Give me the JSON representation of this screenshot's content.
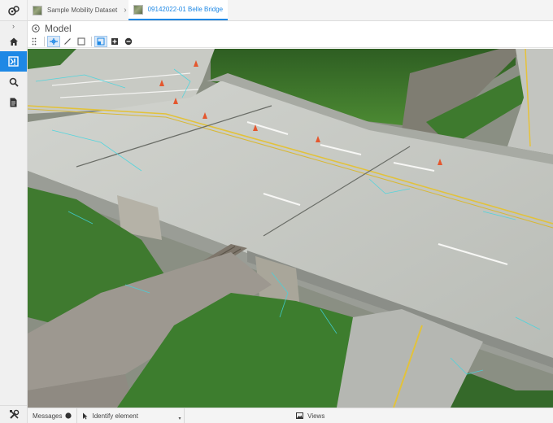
{
  "breadcrumb": {
    "items": [
      {
        "label": "Sample Mobility Dataset",
        "active": false
      },
      {
        "label": "09142022-01 Belle Bridge",
        "active": true
      }
    ]
  },
  "sidebar": {
    "items": [
      {
        "name": "home",
        "icon": "home-icon"
      },
      {
        "name": "model",
        "icon": "model-icon",
        "active": true
      },
      {
        "name": "search",
        "icon": "search-icon"
      },
      {
        "name": "document",
        "icon": "document-icon"
      }
    ],
    "bottom_icon": "tools-icon"
  },
  "panel": {
    "title": "Model"
  },
  "toolbar": {
    "tools": [
      "grip-icon",
      "measure-point-icon",
      "measure-line-icon",
      "box-select-icon",
      "section-icon",
      "add-icon",
      "remove-icon"
    ]
  },
  "status": {
    "messages_label": "Messages",
    "messages_count": "0",
    "identify_label": "Identify element",
    "views_label": "Views"
  },
  "colors": {
    "accent": "#1e88e5",
    "vegetation": "#3f7a2f",
    "road": "#c9cbc5",
    "cone": "#e4572e"
  }
}
